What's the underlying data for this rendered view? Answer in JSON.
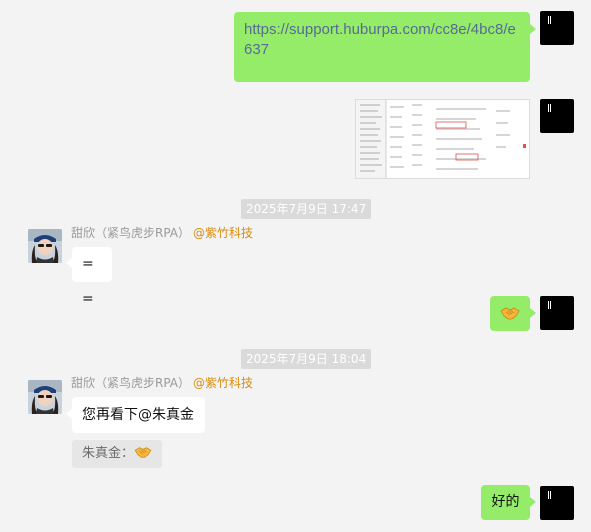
{
  "messages": {
    "link": {
      "text": "https://support.huburpa.com/cc8e/4bc8/e637"
    },
    "timestamp1": "2025年7月9日 17:47",
    "sender1": {
      "name": "甜欣（紧鸟虎步RPA）",
      "mention": "@紫竹科技"
    },
    "reply1_text": "= =",
    "handshake_icon": "handshake-emoji",
    "timestamp2": "2025年7月9日 18:04",
    "sender2": {
      "name": "甜欣（紧鸟虎步RPA）",
      "mention": "@紫竹科技"
    },
    "reply2_text": "您再看下@朱真金",
    "quote": {
      "label": "朱真金："
    },
    "final_reply": "好的"
  },
  "colors": {
    "background": "#f3f3f3",
    "bubble_green": "#95ec69",
    "bubble_white": "#ffffff",
    "link": "#576b95",
    "mention": "#d98c0f",
    "timestamp_bg": "#dadada"
  }
}
